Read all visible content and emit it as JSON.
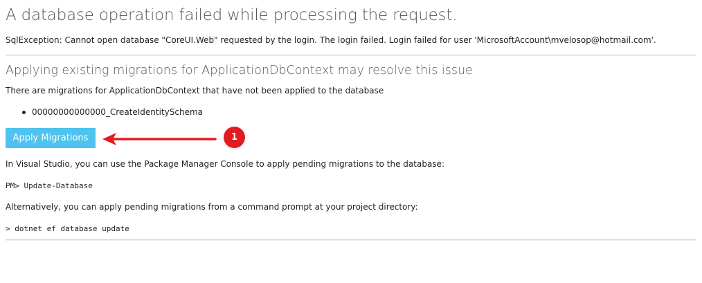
{
  "error": {
    "title": "A database operation failed while processing the request.",
    "message": "SqlException: Cannot open database \"CoreUI.Web\" requested by the login. The login failed. Login failed for user 'MicrosoftAccount\\mvelosop@hotmail.com'."
  },
  "migrations": {
    "heading": "Applying existing migrations for ApplicationDbContext may resolve this issue",
    "description": "There are migrations for ApplicationDbContext that have not been applied to the database",
    "pending": [
      "00000000000000_CreateIdentitySchema"
    ],
    "apply_button_label": "Apply Migrations",
    "button_color": "#4fc3ef"
  },
  "annotation": {
    "badge_number": "1",
    "color": "#e01b22"
  },
  "visual_studio": {
    "text": "In Visual Studio, you can use the Package Manager Console to apply pending migrations to the database:",
    "command": "PM> Update-Database"
  },
  "command_line": {
    "text": "Alternatively, you can apply pending migrations from a command prompt at your project directory:",
    "command": "> dotnet ef database update"
  }
}
